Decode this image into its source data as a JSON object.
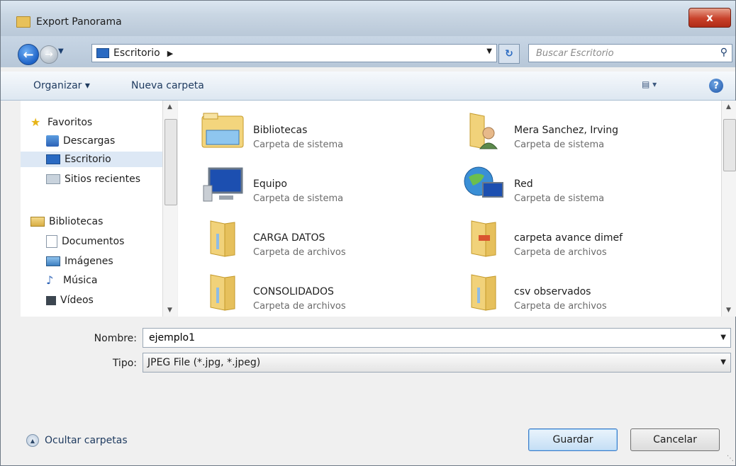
{
  "window": {
    "title": "Export Panorama",
    "close_label": "x"
  },
  "navbar": {
    "address": "Escritorio",
    "search_placeholder": "Buscar Escritorio"
  },
  "toolbar": {
    "organize": "Organizar ▾",
    "new_folder": "Nueva carpeta",
    "view_label": "▾",
    "help_label": "?"
  },
  "sidebar": {
    "favorites": "Favoritos",
    "items_favorites": [
      "Descargas",
      "Escritorio",
      "Sitios recientes"
    ],
    "libraries": "Bibliotecas",
    "items_libraries": [
      "Documentos",
      "Imágenes",
      "Música",
      "Vídeos"
    ],
    "selected": "Escritorio"
  },
  "files": [
    {
      "name": "Bibliotecas",
      "type": "Carpeta de sistema",
      "icon": "libraries-icon"
    },
    {
      "name": "Mera Sanchez, Irving",
      "type": "Carpeta de sistema",
      "icon": "user-folder-icon"
    },
    {
      "name": "Equipo",
      "type": "Carpeta de sistema",
      "icon": "computer-icon"
    },
    {
      "name": "Red",
      "type": "Carpeta de sistema",
      "icon": "network-icon"
    },
    {
      "name": "CARGA DATOS",
      "type": "Carpeta de archivos",
      "icon": "folder-icon"
    },
    {
      "name": "carpeta avance dimef",
      "type": "Carpeta de archivos",
      "icon": "folder-icon"
    },
    {
      "name": "CONSOLIDADOS",
      "type": "Carpeta de archivos",
      "icon": "folder-icon"
    },
    {
      "name": "csv observados",
      "type": "Carpeta de archivos",
      "icon": "folder-icon"
    }
  ],
  "form": {
    "name_label": "Nombre:",
    "name_value": "ejemplo1",
    "type_label": "Tipo:",
    "type_value": "JPEG File (*.jpg, *.jpeg)"
  },
  "footer": {
    "hide_folders": "Ocultar carpetas",
    "save": "Guardar",
    "cancel": "Cancelar"
  }
}
